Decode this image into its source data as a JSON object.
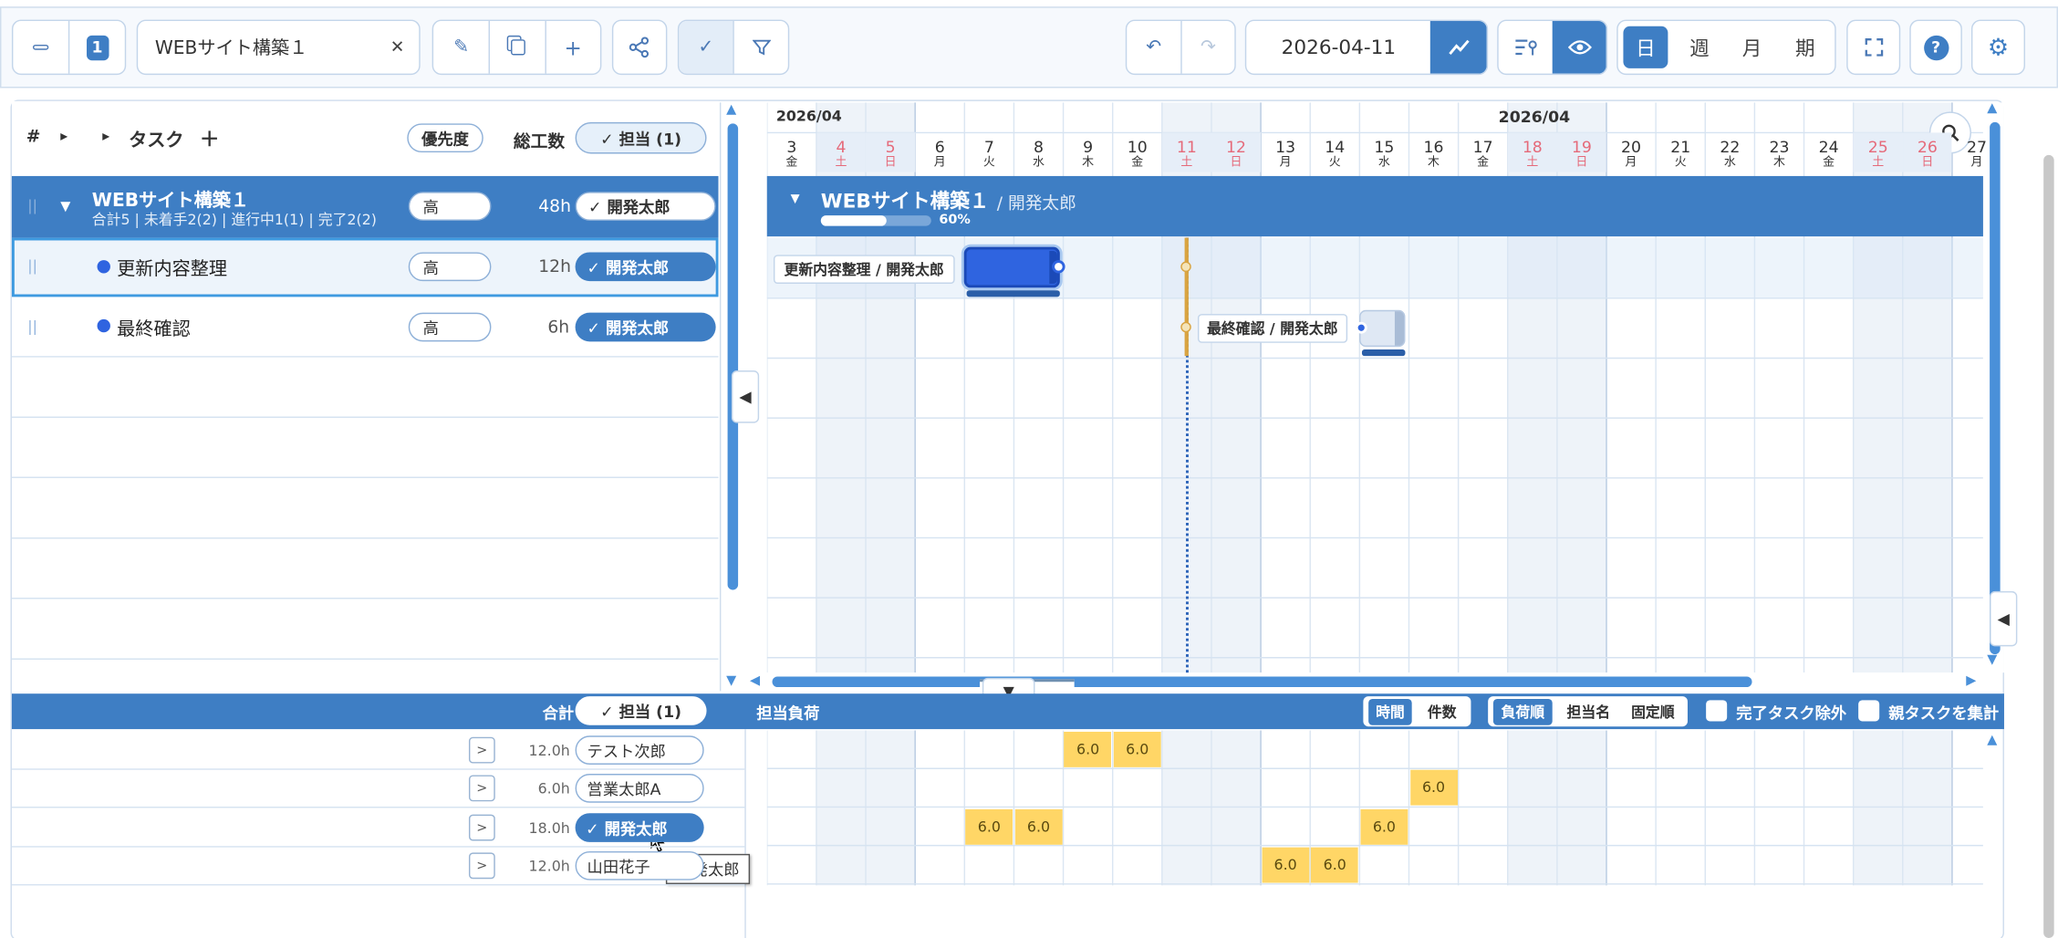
{
  "toolbar": {
    "page_number": "1",
    "project_name": "WEBサイト構築１",
    "clear_symbol": "✕",
    "date": "2026-04-11",
    "view_modes": [
      "日",
      "週",
      "月",
      "期"
    ]
  },
  "table_header": {
    "hash": "#",
    "expand1": "▸",
    "expand2": "▸",
    "task": "タスク",
    "add": "＋",
    "priority": "優先度",
    "total_hours": "総工数",
    "assignee_filter": "✓ 担当 (1)"
  },
  "project_row": {
    "title": "WEBサイト構築１",
    "summary": "合計5 | 未着手2(2) | 進行中1(1) | 完了2(2)",
    "priority": "高",
    "hours": "48h",
    "assignee": "✓ 開発太郎",
    "toggle": "▼"
  },
  "tasks": [
    {
      "name": "更新内容整理",
      "priority": "高",
      "hours": "12h",
      "assignee": "✓ 開発太郎",
      "label": "更新内容整理 / 開発太郎"
    },
    {
      "name": "最終確認",
      "priority": "高",
      "hours": "6h",
      "assignee": "✓ 開発太郎",
      "label": "最終確認 / 開発太郎"
    }
  ],
  "timeline": {
    "month_left": "2026/04",
    "month_center": "2026/04",
    "days": [
      {
        "d": "3",
        "w": "金",
        "red": false
      },
      {
        "d": "4",
        "w": "土",
        "red": true
      },
      {
        "d": "5",
        "w": "日",
        "red": true
      },
      {
        "d": "6",
        "w": "月",
        "red": false
      },
      {
        "d": "7",
        "w": "火",
        "red": false
      },
      {
        "d": "8",
        "w": "水",
        "red": false
      },
      {
        "d": "9",
        "w": "木",
        "red": false
      },
      {
        "d": "10",
        "w": "金",
        "red": false
      },
      {
        "d": "11",
        "w": "土",
        "red": true
      },
      {
        "d": "12",
        "w": "日",
        "red": true
      },
      {
        "d": "13",
        "w": "月",
        "red": false
      },
      {
        "d": "14",
        "w": "火",
        "red": false
      },
      {
        "d": "15",
        "w": "水",
        "red": false
      },
      {
        "d": "16",
        "w": "木",
        "red": false
      },
      {
        "d": "17",
        "w": "金",
        "red": false
      },
      {
        "d": "18",
        "w": "土",
        "red": true
      },
      {
        "d": "19",
        "w": "日",
        "red": true
      },
      {
        "d": "20",
        "w": "月",
        "red": false
      },
      {
        "d": "21",
        "w": "火",
        "red": false
      },
      {
        "d": "22",
        "w": "水",
        "red": false
      },
      {
        "d": "23",
        "w": "木",
        "red": false
      },
      {
        "d": "24",
        "w": "金",
        "red": false
      },
      {
        "d": "25",
        "w": "土",
        "red": true
      },
      {
        "d": "26",
        "w": "日",
        "red": true
      },
      {
        "d": "27",
        "w": "月",
        "red": false
      }
    ],
    "project_bar_title": "WEBサイト構築１",
    "project_bar_owner": "/ 開発太郎",
    "progress_label": "60%",
    "progress": 0.6
  },
  "load_panel": {
    "total_label": "合計",
    "assignee_filter": "✓ 担当 (1)",
    "title": "担当負荷",
    "unit_modes": [
      "時間",
      "件数"
    ],
    "sort_modes": [
      "負荷順",
      "担当名",
      "固定順"
    ],
    "exclude_done": "完了タスク除外",
    "aggregate_parent": "親タスクを集計",
    "chevron": ">",
    "people": [
      {
        "hours": "12.0h",
        "name": "テスト次郎",
        "selected": false
      },
      {
        "hours": "6.0h",
        "name": "営業太郎A",
        "selected": false
      },
      {
        "hours": "18.0h",
        "name": "✓ 開発太郎",
        "selected": true
      },
      {
        "hours": "12.0h",
        "name": "山田花子",
        "selected": false
      }
    ],
    "load_values": [
      [
        {
          "day": "9",
          "v": "6.0"
        },
        {
          "day": "10",
          "v": "6.0"
        }
      ],
      [
        {
          "day": "16",
          "v": "6.0"
        }
      ],
      [
        {
          "day": "7",
          "v": "6.0"
        },
        {
          "day": "8",
          "v": "6.0"
        },
        {
          "day": "15",
          "v": "6.0"
        }
      ],
      [
        {
          "day": "13",
          "v": "6.0"
        },
        {
          "day": "14",
          "v": "6.0"
        }
      ]
    ],
    "tooltip": "開発太郎"
  },
  "colors": {
    "accent": "#3e7ec4",
    "bar": "#2f64e0",
    "load": "#ffd666",
    "today": "#e0a030"
  }
}
